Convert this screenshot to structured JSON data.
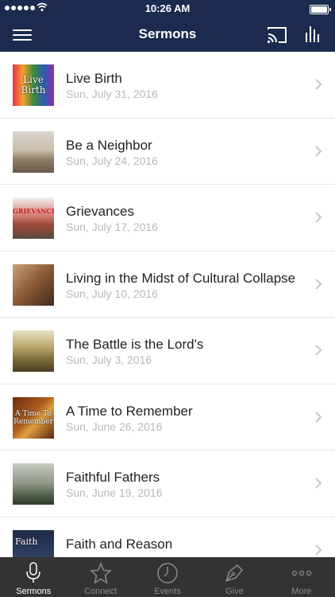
{
  "status": {
    "time": "10:26 AM"
  },
  "header": {
    "title": "Sermons"
  },
  "sermons": [
    {
      "title": "Live Birth",
      "date": "Sun, July 31, 2016",
      "thumb_text": "Live Birth"
    },
    {
      "title": "Be a Neighbor",
      "date": "Sun, July 24, 2016",
      "thumb_text": ""
    },
    {
      "title": "Grievances",
      "date": "Sun, July 17, 2016",
      "thumb_text": "GRIEVANCES"
    },
    {
      "title": "Living in the Midst of Cultural Collapse",
      "date": "Sun, July 10, 2016",
      "thumb_text": ""
    },
    {
      "title": "The Battle is the Lord's",
      "date": "Sun, July 3, 2016",
      "thumb_text": ""
    },
    {
      "title": "A Time to Remember",
      "date": "Sun, June 26, 2016",
      "thumb_text": "A Time To Remember"
    },
    {
      "title": "Faithful Fathers",
      "date": "Sun, June 19, 2016",
      "thumb_text": ""
    },
    {
      "title": "Faith and Reason",
      "date": "",
      "thumb_text": "Faith"
    }
  ],
  "tabs": [
    {
      "label": "Sermons",
      "icon": "microphone-icon",
      "active": true
    },
    {
      "label": "Connect",
      "icon": "star-icon",
      "active": false
    },
    {
      "label": "Events",
      "icon": "clock-icon",
      "active": false
    },
    {
      "label": "Give",
      "icon": "pen-nib-icon",
      "active": false
    },
    {
      "label": "More",
      "icon": "more-dots-icon",
      "active": false
    }
  ],
  "colors": {
    "navbar": "#1b2a4e",
    "tabbar": "#333333",
    "tab_active": "#ffffff",
    "tab_inactive": "#8a8a8a"
  }
}
